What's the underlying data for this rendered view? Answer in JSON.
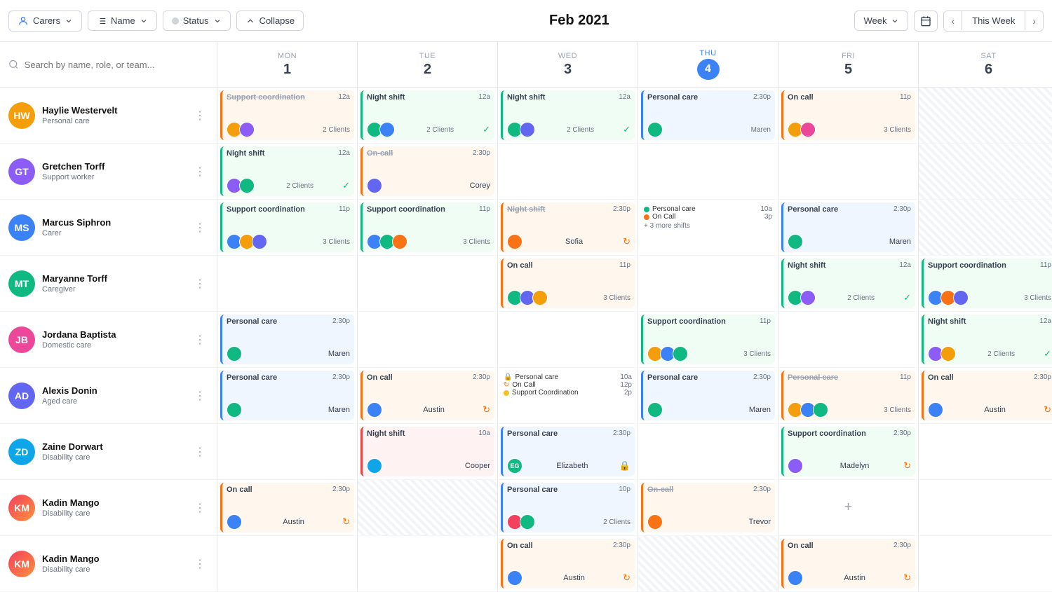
{
  "toolbar": {
    "carers_label": "Carers",
    "name_label": "Name",
    "status_label": "Status",
    "collapse_label": "Collapse",
    "title": "Feb 2021",
    "week_label": "Week",
    "this_week_label": "This Week"
  },
  "search": {
    "placeholder": "Search by name, role, or team..."
  },
  "days": [
    {
      "name": "MON",
      "num": "1",
      "today": false
    },
    {
      "name": "TUE",
      "num": "2",
      "today": false
    },
    {
      "name": "WED",
      "num": "3",
      "today": false
    },
    {
      "name": "THU",
      "num": "4",
      "today": true
    },
    {
      "name": "FRI",
      "num": "5",
      "today": false
    },
    {
      "name": "SAT",
      "num": "6",
      "today": false
    }
  ],
  "carers": [
    {
      "name": "Haylie Westervelt",
      "role": "Personal care",
      "initials": "HW",
      "color": "#f59e0b"
    },
    {
      "name": "Gretchen Torff",
      "role": "Support worker",
      "initials": "GT",
      "color": "#8b5cf6"
    },
    {
      "name": "Marcus Siphron",
      "role": "Carer",
      "initials": "MS",
      "color": "#3b82f6"
    },
    {
      "name": "Maryanne Torff",
      "role": "Caregiver",
      "initials": "MT",
      "color": "#10b981"
    },
    {
      "name": "Jordana Baptista",
      "role": "Domestic care",
      "initials": "JB",
      "color": "#ec4899"
    },
    {
      "name": "Alexis Donin",
      "role": "Aged care",
      "initials": "AD",
      "color": "#6366f1"
    },
    {
      "name": "Zaine Dorwart",
      "role": "Disability care",
      "initials": "ZD",
      "color": "#0ea5e9"
    },
    {
      "name": "Kadin Mango",
      "role": "Disability care",
      "initials": "KM",
      "color": "#f43f5e"
    },
    {
      "name": "Kadin Mango",
      "role": "Disability care",
      "initials": "KM",
      "color": "#f43f5e"
    }
  ]
}
